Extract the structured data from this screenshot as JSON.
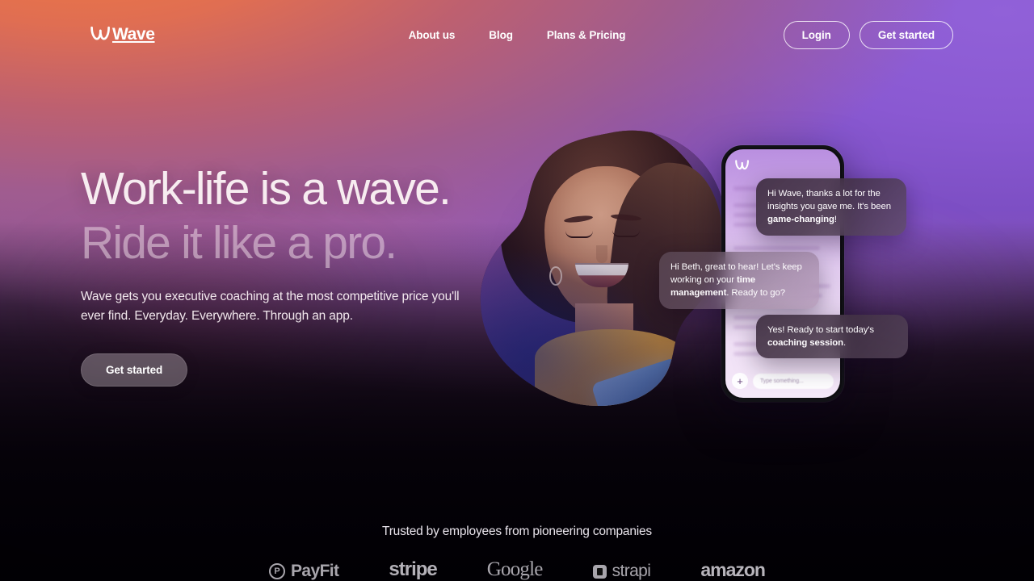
{
  "brand": {
    "name": "Wave",
    "logo_icon": "wave-logo-icon"
  },
  "nav": {
    "links": [
      {
        "label": "About us",
        "name": "nav-link-about-us"
      },
      {
        "label": "Blog",
        "name": "nav-link-blog"
      },
      {
        "label": "Plans & Pricing",
        "name": "nav-link-plans-pricing"
      }
    ],
    "login_label": "Login",
    "get_started_label": "Get started"
  },
  "hero": {
    "headline_line1": "Work-life is a wave.",
    "headline_line2": "Ride it like a pro.",
    "subhead": "Wave gets you executive coaching at the most competitive price you'll ever find. Everyday. Everywhere. Through an app.",
    "cta_label": "Get started"
  },
  "phone": {
    "logo_icon": "wave-logo-icon",
    "input_placeholder": "Type something...",
    "plus_icon": "plus-icon"
  },
  "chat": {
    "bubbles": [
      {
        "name": "chat-bubble-user-1",
        "parts": [
          {
            "text": "Hi Wave, thanks a lot for the insights you gave me. It's been ",
            "bold": false
          },
          {
            "text": "game-changing",
            "bold": true
          },
          {
            "text": "!",
            "bold": false
          }
        ]
      },
      {
        "name": "chat-bubble-coach-1",
        "parts": [
          {
            "text": "Hi Beth, great to hear! Let's keep working on your ",
            "bold": false
          },
          {
            "text": "time management",
            "bold": true
          },
          {
            "text": ". Ready to go?",
            "bold": false
          }
        ]
      },
      {
        "name": "chat-bubble-user-2",
        "parts": [
          {
            "text": "Yes! Ready to start today's ",
            "bold": false
          },
          {
            "text": "coaching session",
            "bold": true
          },
          {
            "text": ".",
            "bold": false
          }
        ]
      }
    ]
  },
  "trusted": {
    "label": "Trusted by employees from pioneering companies",
    "logos": [
      {
        "name": "logo-payfit",
        "text": "PayFit",
        "mark": "circle-p"
      },
      {
        "name": "logo-stripe",
        "text": "stripe",
        "mark": "none"
      },
      {
        "name": "logo-google",
        "text": "Google",
        "mark": "none"
      },
      {
        "name": "logo-strapi",
        "text": "strapi",
        "mark": "square"
      },
      {
        "name": "logo-amazon",
        "text": "amazon",
        "mark": "none"
      }
    ]
  },
  "colors": {
    "gradient_top_left": "#f07a3e",
    "gradient_top_right": "#9161d8",
    "gradient_mid": "#a663b4",
    "gradient_bottom": "#050208",
    "text_primary": "#f7ecf0",
    "phone_screen": "#e3cdf1"
  }
}
